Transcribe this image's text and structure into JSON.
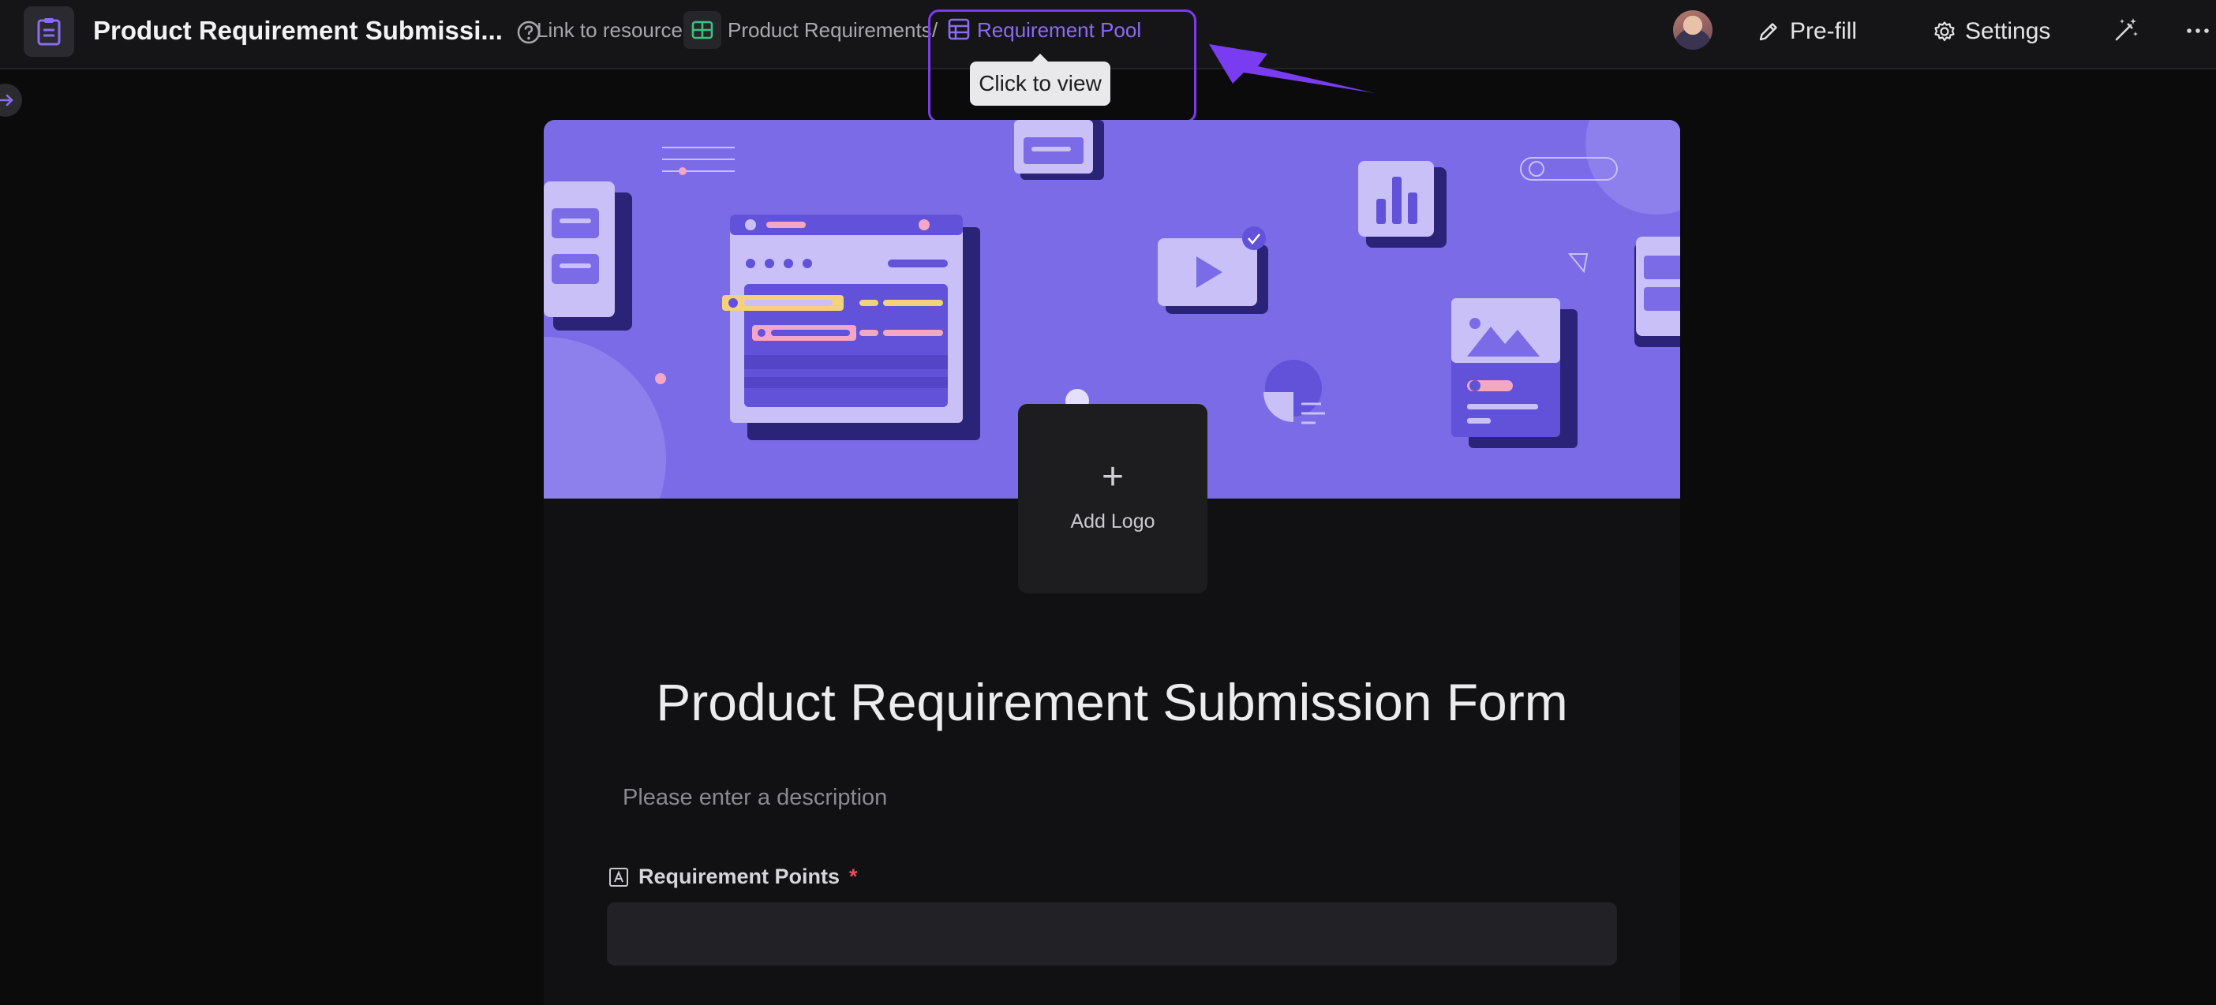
{
  "header": {
    "title": "Product Requirement Submissi...",
    "link_label": "Link to resource:",
    "breadcrumb_base": "Product Requirements",
    "breadcrumb_separator": "/",
    "breadcrumb_view": "Requirement Pool",
    "tooltip": "Click to view",
    "prefill_label": "Pre-fill",
    "settings_label": "Settings"
  },
  "form": {
    "add_logo_plus": "+",
    "add_logo_label": "Add Logo",
    "title": "Product Requirement Submission Form",
    "description_placeholder": "Please enter a description",
    "field_label": "Requirement Points",
    "required_mark": "*"
  },
  "colors": {
    "accent": "#7a3cf0",
    "link": "#8b6cf0",
    "banner": "#7b6be6",
    "required": "#ef4a5c"
  },
  "icons": [
    "form-icon",
    "help-icon",
    "grid-base-icon",
    "table-view-icon",
    "pencil-icon",
    "gear-icon",
    "magic-wand-icon",
    "more-icon",
    "arrow-right-icon"
  ]
}
